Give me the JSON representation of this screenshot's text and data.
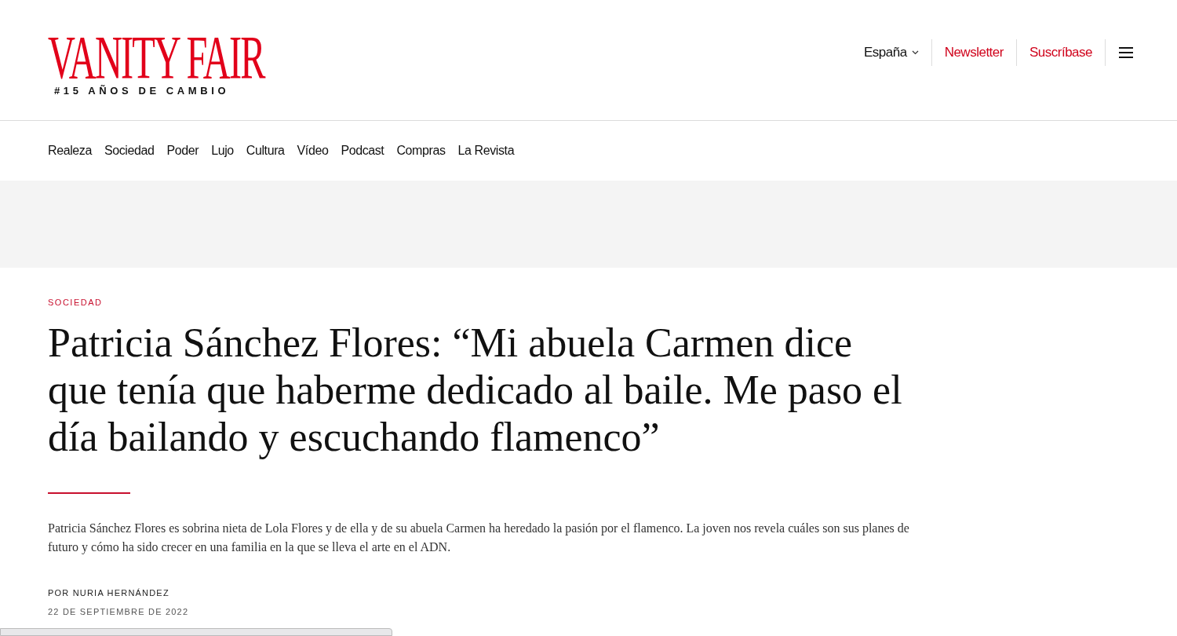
{
  "header": {
    "logo": "VANITY FAIR",
    "tagline": "#15 AÑOS DE CAMBIO",
    "edition": "España",
    "links": [
      "Newsletter",
      "Suscríbase"
    ]
  },
  "nav": [
    "Realeza",
    "Sociedad",
    "Poder",
    "Lujo",
    "Cultura",
    "Vídeo",
    "Podcast",
    "Compras",
    "La Revista"
  ],
  "article": {
    "section": "SOCIEDAD",
    "title": "Patricia Sánchez Flores: “Mi abuela Carmen dice que tenía que haberme dedicado al baile. Me paso el día bailando y escuchando flamenco”",
    "dek": "Patricia Sánchez Flores es sobrina nieta de Lola Flores y de ella y de su abuela Carmen ha heredado la pasión por el flamenco. La joven nos revela cuáles son sus planes de futuro y cómo ha sido crecer en una familia en la que se lleva el arte en el ADN.",
    "byline": "POR NURIA HERNÁNDEZ",
    "date": "22 DE SEPTIEMBRE DE 2022"
  }
}
